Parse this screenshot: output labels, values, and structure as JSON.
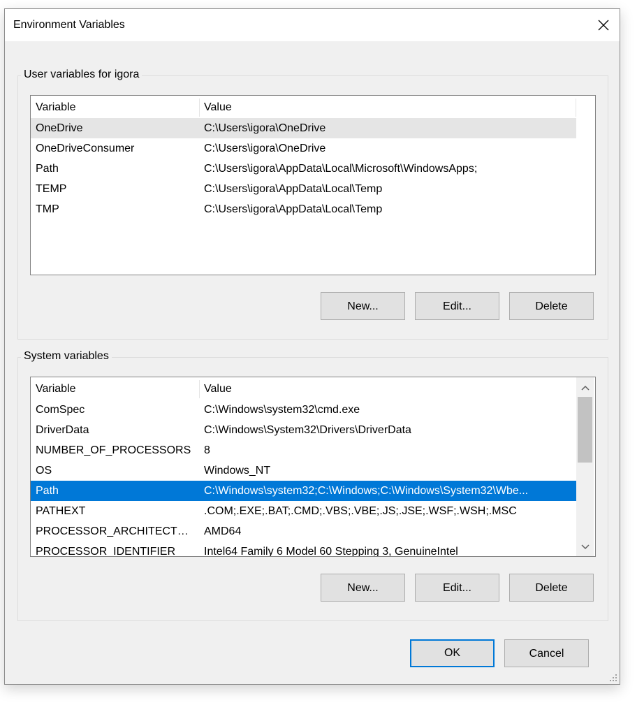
{
  "window": {
    "title": "Environment Variables"
  },
  "user_vars": {
    "label": "User variables for igora",
    "headers": {
      "variable": "Variable",
      "value": "Value"
    },
    "rows": [
      {
        "name": "OneDrive",
        "value": "C:\\Users\\igora\\OneDrive"
      },
      {
        "name": "OneDriveConsumer",
        "value": "C:\\Users\\igora\\OneDrive"
      },
      {
        "name": "Path",
        "value": "C:\\Users\\igora\\AppData\\Local\\Microsoft\\WindowsApps;"
      },
      {
        "name": "TEMP",
        "value": "C:\\Users\\igora\\AppData\\Local\\Temp"
      },
      {
        "name": "TMP",
        "value": "C:\\Users\\igora\\AppData\\Local\\Temp"
      }
    ],
    "buttons": {
      "new": "New...",
      "edit": "Edit...",
      "delete": "Delete"
    }
  },
  "system_vars": {
    "label": "System variables",
    "headers": {
      "variable": "Variable",
      "value": "Value"
    },
    "rows": [
      {
        "name": "ComSpec",
        "value": "C:\\Windows\\system32\\cmd.exe"
      },
      {
        "name": "DriverData",
        "value": "C:\\Windows\\System32\\Drivers\\DriverData"
      },
      {
        "name": "NUMBER_OF_PROCESSORS",
        "value": "8"
      },
      {
        "name": "OS",
        "value": "Windows_NT"
      },
      {
        "name": "Path",
        "value": "C:\\Windows\\system32;C:\\Windows;C:\\Windows\\System32\\Wbe..."
      },
      {
        "name": "PATHEXT",
        "value": ".COM;.EXE;.BAT;.CMD;.VBS;.VBE;.JS;.JSE;.WSF;.WSH;.MSC"
      },
      {
        "name": "PROCESSOR_ARCHITECTURE",
        "value": "AMD64"
      },
      {
        "name": "PROCESSOR_IDENTIFIER",
        "value": "Intel64 Family 6 Model 60 Stepping 3, GenuineIntel"
      }
    ],
    "selected_row": "Path",
    "buttons": {
      "new": "New...",
      "edit": "Edit...",
      "delete": "Delete"
    }
  },
  "footer": {
    "ok": "OK",
    "cancel": "Cancel"
  },
  "colors": {
    "selection": "#0078d7",
    "hover": "#e5e5e5",
    "dialog_bg": "#f0f0f0"
  },
  "icons": [
    "close-icon",
    "chevron-up-icon",
    "chevron-down-icon",
    "resize-grip-icon"
  ]
}
